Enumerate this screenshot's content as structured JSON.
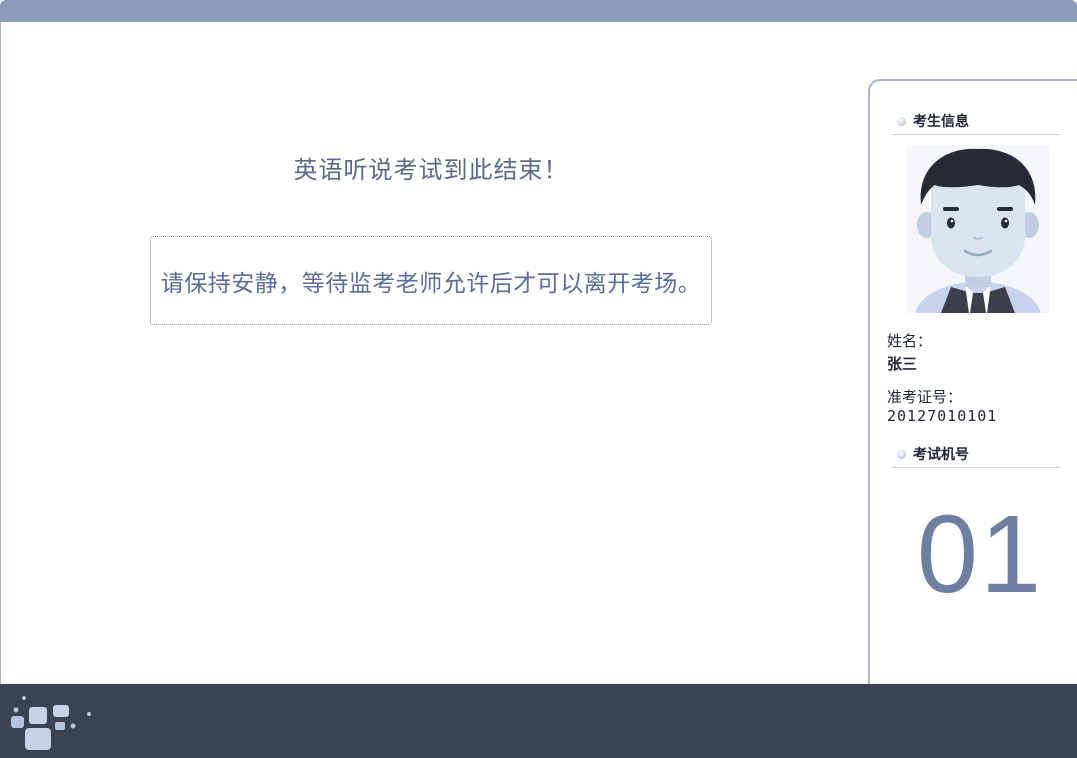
{
  "main": {
    "title": "英语听说考试到此结束！",
    "notice": "请保持安静，等待监考老师允许后才可以离开考场。"
  },
  "side_panel": {
    "candidate_section": "考生信息",
    "name_label": "姓名：",
    "name_value": "张三",
    "ticket_label": "准考证号：",
    "ticket_value": "20127010101",
    "machine_section": "考试机号",
    "machine_number": "01"
  },
  "colors": {
    "top_bar": "#8c9bb8",
    "bottom_bar": "#3d4253",
    "title_text": "#5c6a85",
    "machine_number": "#6f7f9f"
  },
  "icons": [
    "bullet-dot-icon",
    "avatar-icon",
    "logo-icon"
  ]
}
